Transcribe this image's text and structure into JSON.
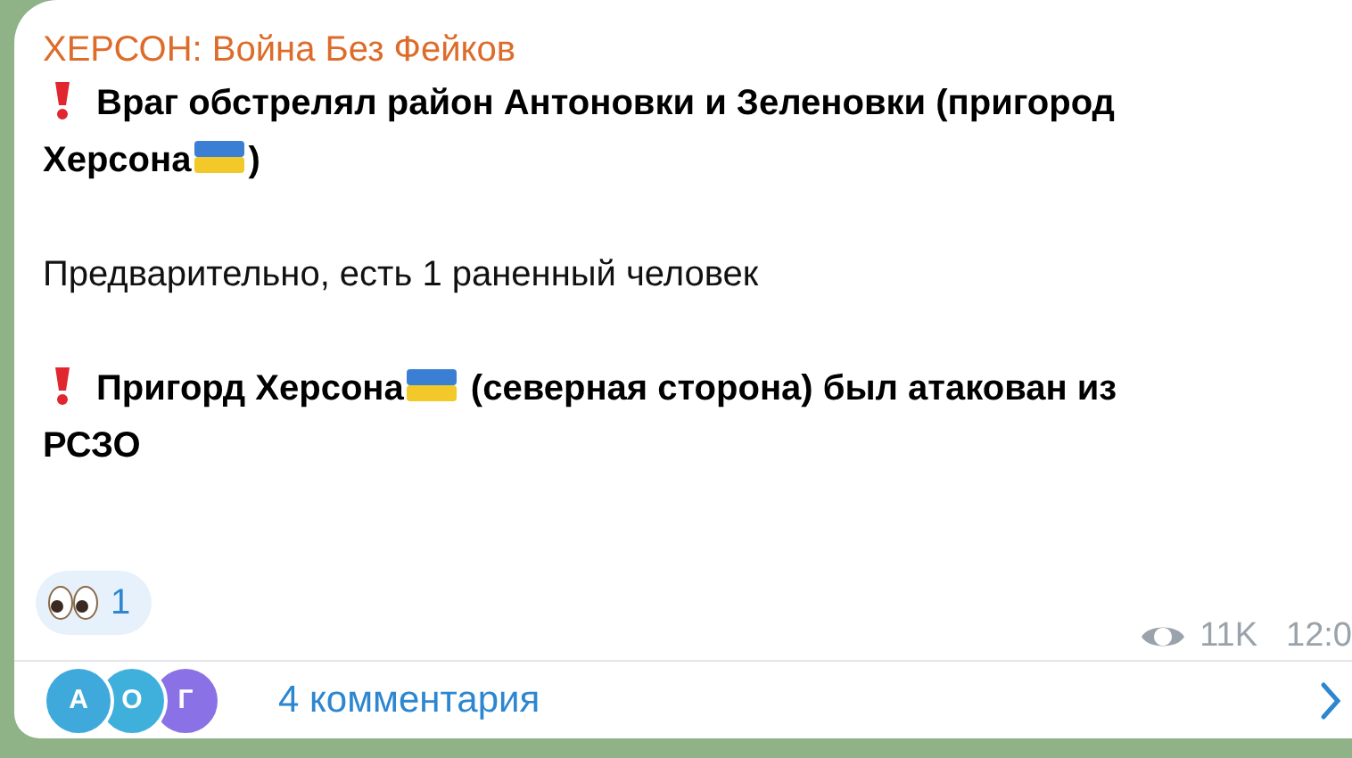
{
  "channel_title": "ХЕРСОН: Война Без Фейков",
  "paragraphs": [
    {
      "kind": "alert",
      "text_before": "Враг обстрелял район Антоновки и Зеленовки (пригород Херсона",
      "flag": true,
      "text_after": ")"
    },
    {
      "kind": "plain",
      "text_before": "Предварительно, есть 1 раненный человек",
      "flag": false
    },
    {
      "kind": "alert",
      "text_before": "Пригорд Херсона",
      "flag": true,
      "text_after": " (северная сторона) был атакован из РСЗО"
    }
  ],
  "reactions": [
    {
      "count": "1",
      "selected": false
    }
  ],
  "views": "11K",
  "time": "12:0",
  "comments": {
    "avatars": [
      {
        "letter": "А",
        "color": "#3fa9dc"
      },
      {
        "letter": "О",
        "color": "#3fb0dc"
      },
      {
        "letter": "Г",
        "color": "#8a72e6"
      }
    ],
    "label": "4 комментария"
  }
}
